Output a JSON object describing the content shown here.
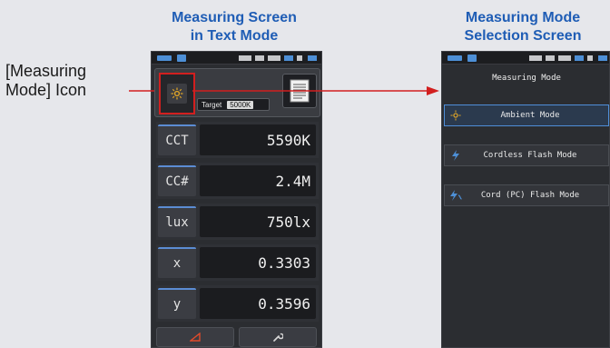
{
  "captions": {
    "left": [
      "Measuring Screen",
      "in Text Mode"
    ],
    "right": [
      "Measuring Mode",
      "Selection Screen"
    ],
    "icon_label": [
      "[Measuring",
      "Mode] Icon"
    ]
  },
  "colors": {
    "caption": "#1f5db5",
    "highlight": "#d21f1f",
    "sun_icon": "#e0a526",
    "flash_icon": "#4d8fd6"
  },
  "measuring_screen": {
    "target_label": "Target",
    "target_value": "5000K",
    "mode_icon": "sun-icon",
    "rows": [
      {
        "label": "CCT",
        "value": "5590K"
      },
      {
        "label": "CC#",
        "value": "2.4M"
      },
      {
        "label": "lux",
        "value": "750lx"
      },
      {
        "label": "x",
        "value": "0.3303"
      },
      {
        "label": "y",
        "value": "0.3596"
      }
    ],
    "bottom_buttons": [
      "triangle-icon",
      "wrench-icon"
    ]
  },
  "mode_selection_screen": {
    "title": "Measuring Mode",
    "items": [
      {
        "label": "Ambient Mode",
        "icon": "sun-icon",
        "selected": true
      },
      {
        "label": "Cordless Flash Mode",
        "icon": "flash-icon",
        "selected": false
      },
      {
        "label": "Cord (PC) Flash Mode",
        "icon": "cord-flash-icon",
        "selected": false
      }
    ]
  }
}
